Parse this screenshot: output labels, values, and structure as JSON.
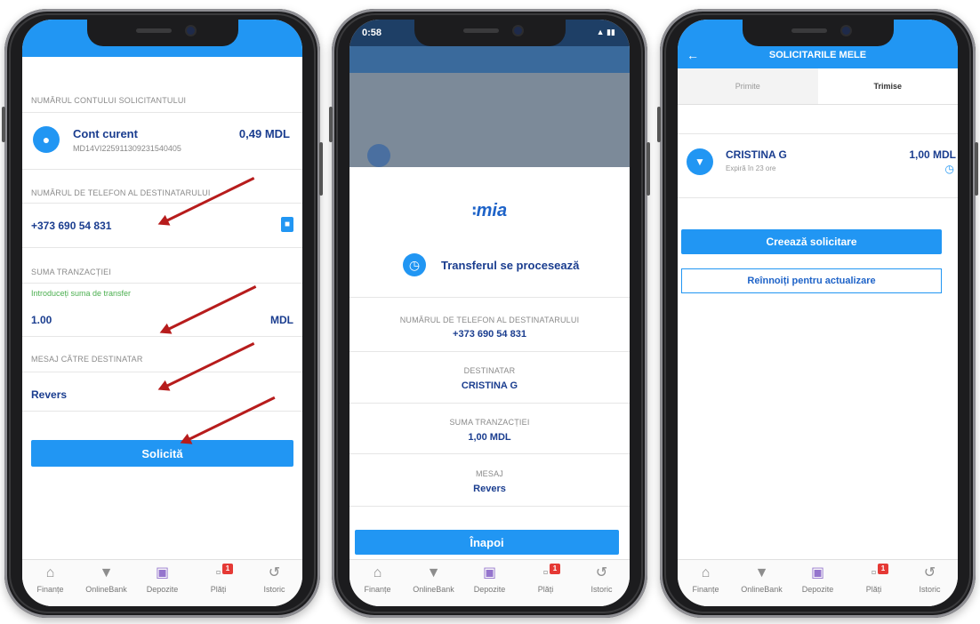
{
  "phone1": {
    "account_label": "NUMĂRUL CONTULUI SOLICITANTULUI",
    "account_name": "Cont curent",
    "account_number": "MD14VI225911309231540405",
    "account_balance": "0,49 MDL",
    "phone_label": "NUMĂRUL DE TELEFON AL DESTINATARULUI",
    "phone_value": "+373  690 54 831",
    "amount_label": "SUMA TRANZACȚIEI",
    "amount_hint": "Introduceți suma de transfer",
    "amount_value": "1.00",
    "currency": "MDL",
    "message_label": "MESAJ CĂTRE DESTINATAR",
    "message_value": "Revers",
    "submit_label": "Solicită"
  },
  "phone2": {
    "status_time": "0:58",
    "logo": "mia",
    "processing_text": "Transferul se procesează",
    "phone_label": "NUMĂRUL DE TELEFON AL DESTINATARULUI",
    "phone_value": "+373 690 54 831",
    "recipient_label": "DESTINATAR",
    "recipient_value": "CRISTINA G",
    "amount_label": "SUMA TRANZACȚIEI",
    "amount_value": "1,00 MDL",
    "message_label": "MESAJ",
    "message_value": "Revers",
    "back_label": "Înapoi"
  },
  "phone3": {
    "title": "SOLICITARILE MELE",
    "tab_received": "Primite",
    "tab_sent": "Trimise",
    "request_name": "CRISTINA G",
    "request_expiry": "Expiră în 23 ore",
    "request_amount": "1,00 MDL",
    "create_label": "Creează solicitare",
    "refresh_label": "Reînnoiți pentru actualizare"
  },
  "nav": {
    "finance": "Finanțe",
    "onlinebank": "OnlineBank",
    "deposits": "Depozite",
    "payments": "Plăți",
    "history": "Istoric",
    "payments_badge": "1"
  },
  "colors": {
    "accent": "#2196f3",
    "arrow": "#b71c1c",
    "text_blue": "#1a3d8f"
  },
  "icons": [
    "home-icon",
    "onlinebank-icon",
    "deposit-icon",
    "payments-icon",
    "history-icon",
    "contact-book-icon",
    "clock-icon",
    "back-arrow-icon"
  ]
}
